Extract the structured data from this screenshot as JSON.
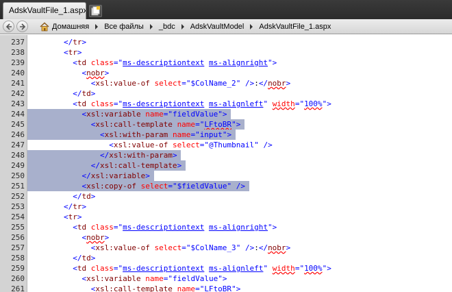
{
  "tab": {
    "title": "AdskVaultFile_1.aspx"
  },
  "breadcrumb": {
    "items": [
      "Домашняя",
      "Все файлы",
      "_bdc",
      "AdskVaultModel",
      "AdskVaultFile_1.aspx"
    ]
  },
  "editor": {
    "selection_color": "#a8b0cc",
    "lines": [
      {
        "n": "237",
        "code": "        </tr>"
      },
      {
        "n": "238",
        "code": "        <tr>"
      },
      {
        "n": "239",
        "code": "          <td class=\"ms-descriptiontext ms-alignright\">"
      },
      {
        "n": "240",
        "code": "            <nobr>"
      },
      {
        "n": "241",
        "code": "              <xsl:value-of select=\"$ColName_2\" />:</nobr>"
      },
      {
        "n": "242",
        "code": "          </td>"
      },
      {
        "n": "243",
        "code": "          <td class=\"ms-descriptiontext ms-alignleft\" width=\"100%\">"
      },
      {
        "n": "244",
        "code": "            <xsl:variable name=\"fieldValue\">"
      },
      {
        "n": "245",
        "code": "              <xsl:call-template name=\"LFtoBR\">"
      },
      {
        "n": "246",
        "code": "                <xsl:with-param name=\"input\">"
      },
      {
        "n": "247",
        "code": "                  <xsl:value-of select=\"@Thumbnail\" />"
      },
      {
        "n": "248",
        "code": "                </xsl:with-param>"
      },
      {
        "n": "249",
        "code": "              </xsl:call-template>"
      },
      {
        "n": "250",
        "code": "            </xsl:variable>"
      },
      {
        "n": "251",
        "code": "            <xsl:copy-of select=\"$fieldValue\" />"
      },
      {
        "n": "252",
        "code": "          </td>"
      },
      {
        "n": "253",
        "code": "        </tr>"
      },
      {
        "n": "254",
        "code": "        <tr>"
      },
      {
        "n": "255",
        "code": "          <td class=\"ms-descriptiontext ms-alignright\">"
      },
      {
        "n": "256",
        "code": "            <nobr>"
      },
      {
        "n": "257",
        "code": "              <xsl:value-of select=\"$ColName_3\" />:</nobr>"
      },
      {
        "n": "258",
        "code": "          </td>"
      },
      {
        "n": "259",
        "code": "          <td class=\"ms-descriptiontext ms-alignleft\" width=\"100%\">"
      },
      {
        "n": "260",
        "code": "            <xsl:variable name=\"fieldValue\">"
      },
      {
        "n": "261",
        "code": "              <xsl:call-template name=\"LFtoBR\">"
      }
    ]
  }
}
